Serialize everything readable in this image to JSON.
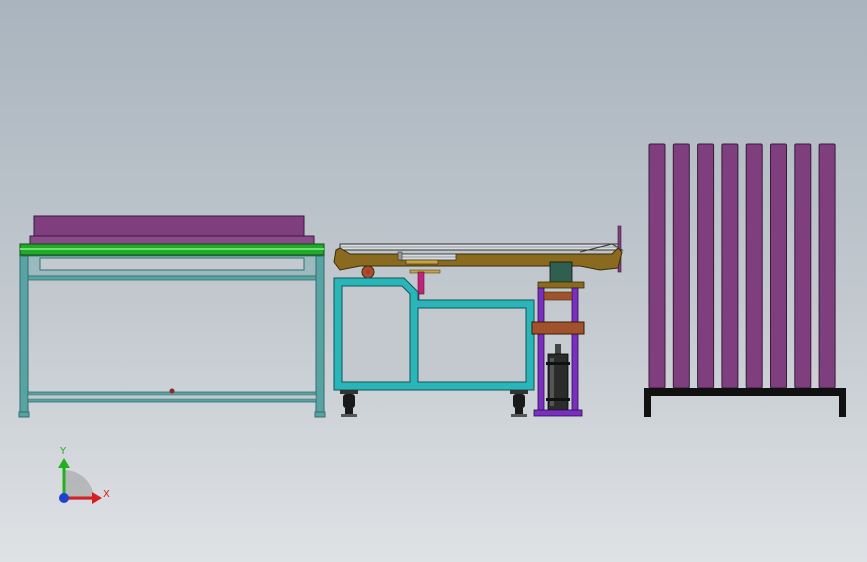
{
  "colors": {
    "frame_teal": "#5aa3a3",
    "frame_cyan": "#2ab5b9",
    "plate_purple": "#7f3f7f",
    "belt_green": "#22a82a",
    "carriage_olive": "#8a6a1e",
    "bracket_brown": "#a0522d",
    "rack_black": "#111111",
    "cylinder_dark": "#2b2b2b",
    "accent_magenta": "#c0247a",
    "axis_x": "#d42020",
    "axis_y": "#20b020",
    "axis_origin": "#2040d0"
  },
  "triad": {
    "x_label": "X",
    "y_label": "Y"
  },
  "rack": {
    "panel_count": 8
  }
}
